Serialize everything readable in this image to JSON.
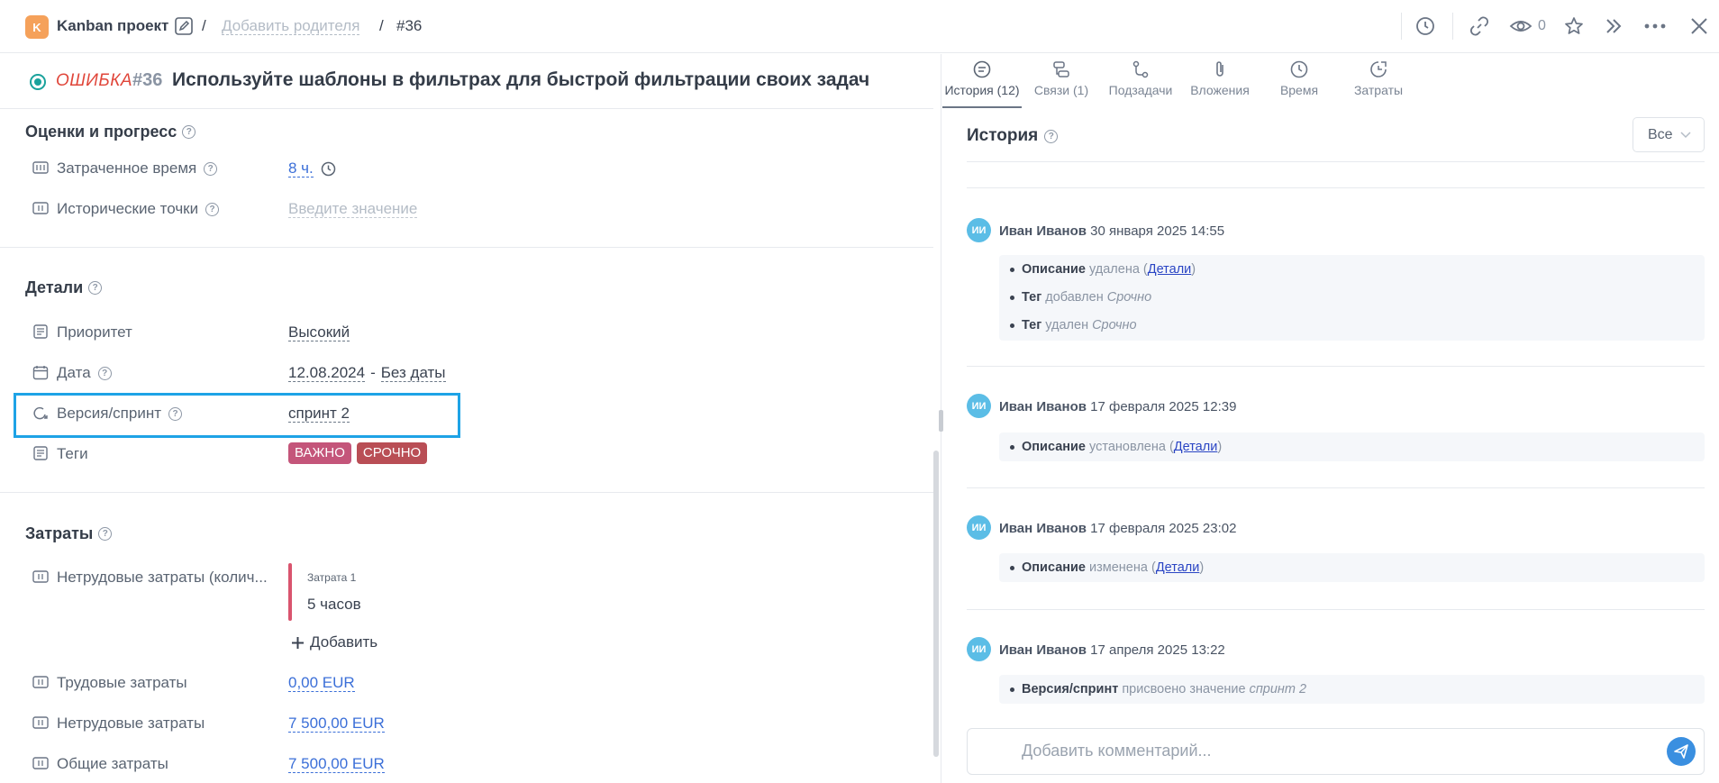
{
  "header": {
    "project_badge": "K",
    "project_name": "Kanban проект",
    "sep": "/",
    "add_parent": "Добавить родителя",
    "issue_ref": "#36",
    "watch_count": "0"
  },
  "issue": {
    "type": "ОШИБКА",
    "id": "#36",
    "title": "Используйте шаблоны в фильтрах для быстрой фильтрации своих задач"
  },
  "estimates": {
    "title": "Оценки и прогресс",
    "spent_label": "Затраченное время",
    "spent_value": "8 ч.",
    "points_label": "Исторические точки",
    "points_placeholder": "Введите значение"
  },
  "details": {
    "title": "Детали",
    "priority_label": "Приоритет",
    "priority_value": "Высокий",
    "date_label": "Дата",
    "date_start": "12.08.2024",
    "date_sep": "-",
    "date_end": "Без даты",
    "sprint_label": "Версия/спринт",
    "sprint_value": "спринт 2",
    "tags_label": "Теги",
    "tags": [
      {
        "label": "ВАЖНО",
        "color": "#c4557a"
      },
      {
        "label": "СРОЧНО",
        "color": "#b94e55"
      }
    ]
  },
  "costs": {
    "title": "Затраты",
    "nonlabor_qty_label": "Нетрудовые затраты (колич...",
    "card_name": "Затрата 1",
    "card_value": "5 часов",
    "add_label": "Добавить",
    "labor_label": "Трудовые затраты",
    "labor_value": "0,00 EUR",
    "nonlabor_label": "Нетрудовые затраты",
    "nonlabor_value": "7 500,00 EUR",
    "total_label": "Общие затраты",
    "total_value": "7 500,00 EUR"
  },
  "right_tabs": [
    {
      "label": "История (12)",
      "icon": "history-list-icon"
    },
    {
      "label": "Связи (1)",
      "icon": "links-icon"
    },
    {
      "label": "Подзадачи",
      "icon": "subtasks-icon"
    },
    {
      "label": "Вложения",
      "icon": "paperclip-icon"
    },
    {
      "label": "Время",
      "icon": "clock-icon"
    },
    {
      "label": "Затраты",
      "icon": "costs-icon"
    }
  ],
  "history": {
    "title": "История",
    "filter": "Все",
    "entries": [
      {
        "initials": "ИИ",
        "author": "Иван Иванов",
        "date": "30 января 2025 14:55",
        "changes": [
          {
            "field": "Описание",
            "action": "удалена",
            "open": "(",
            "link": "Детали",
            "close": ")"
          },
          {
            "field": "Тег",
            "action": "добавлен",
            "value": "Срочно"
          },
          {
            "field": "Тег",
            "action": "удален",
            "value": "Срочно"
          }
        ]
      },
      {
        "initials": "ИИ",
        "author": "Иван Иванов",
        "date": "17 февраля 2025 12:39",
        "changes": [
          {
            "field": "Описание",
            "action": "установлена",
            "open": "(",
            "link": "Детали",
            "close": ")"
          }
        ]
      },
      {
        "initials": "ИИ",
        "author": "Иван Иванов",
        "date": "17 февраля 2025 23:02",
        "changes": [
          {
            "field": "Описание",
            "action": "изменена",
            "open": "(",
            "link": "Детали",
            "close": ")"
          }
        ]
      },
      {
        "initials": "ИИ",
        "author": "Иван Иванов",
        "date": "17 апреля 2025 13:22",
        "changes": [
          {
            "field": "Версия/спринт",
            "action": "присвоено значение",
            "value": "спринт 2"
          }
        ]
      }
    ]
  },
  "comment": {
    "placeholder": "Добавить комментарий..."
  },
  "colors": {
    "accent": "#3b6fd8",
    "highlight": "#1ea3e6",
    "project_badge": "#f5a15a",
    "issue_type": "#e0463a"
  }
}
